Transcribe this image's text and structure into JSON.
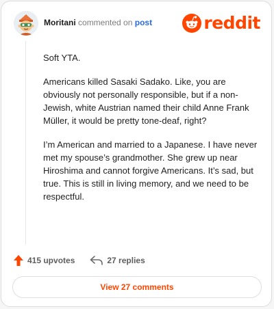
{
  "header": {
    "username": "Moritani",
    "action_text": "commented on",
    "post_link": "post",
    "brand": "reddit",
    "brand_color": "#ff4500",
    "avatar_icon": "cartoon-avatar"
  },
  "comment": {
    "paragraphs": [
      "Soft YTA.",
      "Americans killed Sasaki Sadako. Like, you are obviously not personally responsible, but if a non-Jewish, white Austrian named their child Anne Frank Müller, it would be pretty tone-deaf, right?",
      "I’m American and married to a Japanese. I have never met my spouse’s grandmother. She grew up near Hiroshima and cannot forgive Americans. It’s sad, but true. This is still in living memory, and we need to be respectful."
    ]
  },
  "actions": {
    "upvotes_label": "415 upvotes",
    "replies_label": "27 replies",
    "upvote_icon": "upvote-arrow-icon",
    "reply_icon": "reply-arrow-icon"
  },
  "footer": {
    "view_comments_label": "View 27 comments"
  }
}
